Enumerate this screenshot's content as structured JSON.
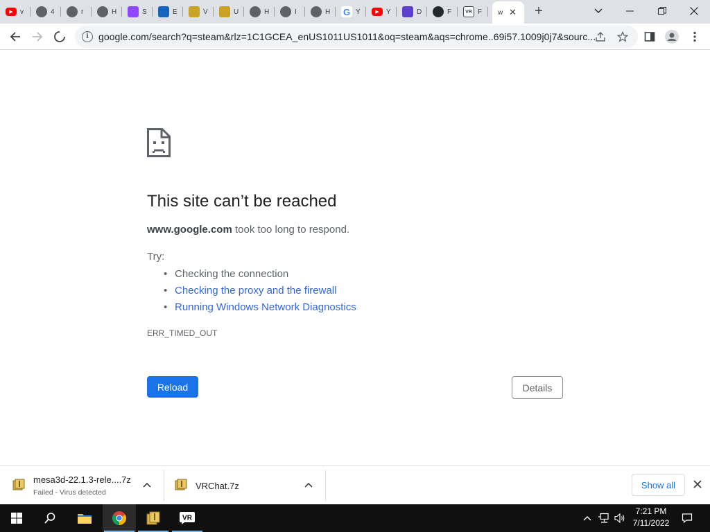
{
  "browser": {
    "tabs": [
      {
        "favicon": "youtube-icon",
        "label": "v",
        "color": "#ff0000"
      },
      {
        "favicon": "globe-icon",
        "label": "4",
        "color": "#5f6368"
      },
      {
        "favicon": "globe-icon",
        "label": "r",
        "color": "#5f6368"
      },
      {
        "favicon": "globe-icon",
        "label": "H",
        "color": "#5f6368"
      },
      {
        "favicon": "twitch-icon",
        "label": "S",
        "color": "#9146ff"
      },
      {
        "favicon": "site-icon",
        "label": "E",
        "color": "#1565c0"
      },
      {
        "favicon": "archive-icon",
        "label": "V",
        "color": "#c9a227"
      },
      {
        "favicon": "archive-icon",
        "label": "U",
        "color": "#c9a227"
      },
      {
        "favicon": "globe-icon",
        "label": "H",
        "color": "#5f6368"
      },
      {
        "favicon": "globe-icon",
        "label": "I",
        "color": "#5f6368"
      },
      {
        "favicon": "globe-icon",
        "label": "H",
        "color": "#5f6368"
      },
      {
        "favicon": "google-icon",
        "label": "Y",
        "color": "#4285f4"
      },
      {
        "favicon": "youtube-icon",
        "label": "Y",
        "color": "#ff0000"
      },
      {
        "favicon": "site-icon",
        "label": "D",
        "color": "#5c3fd1"
      },
      {
        "favicon": "github-icon",
        "label": "F",
        "color": "#24292f"
      },
      {
        "favicon": "vrchat-icon",
        "label": "F",
        "color": "#3c4043"
      }
    ],
    "active_tab": {
      "label": "w",
      "close": "✕"
    },
    "new_tab": "+",
    "url": "google.com/search?q=steam&rlz=1C1GCEA_enUS1011US1011&oq=steam&aqs=chrome..69i57.1009j0j7&sourc..."
  },
  "error_page": {
    "title": "This site can’t be reached",
    "host": "www.google.com",
    "desc_suffix": " took too long to respond.",
    "try_label": "Try:",
    "suggestions": [
      {
        "text": "Checking the connection",
        "link": false
      },
      {
        "text": "Checking the proxy and the firewall",
        "link": true
      },
      {
        "text": "Running Windows Network Diagnostics",
        "link": true
      }
    ],
    "error_code": "ERR_TIMED_OUT",
    "reload_label": "Reload",
    "details_label": "Details"
  },
  "downloads": {
    "items": [
      {
        "name": "mesa3d-22.1.3-rele....7z",
        "status": "Failed - Virus detected",
        "icon": "archive-icon"
      },
      {
        "name": "VRChat.7z",
        "status": "",
        "icon": "archive-icon"
      }
    ],
    "show_all": "Show all"
  },
  "taskbar": {
    "time": "7:21 PM",
    "date": "7/11/2022"
  }
}
